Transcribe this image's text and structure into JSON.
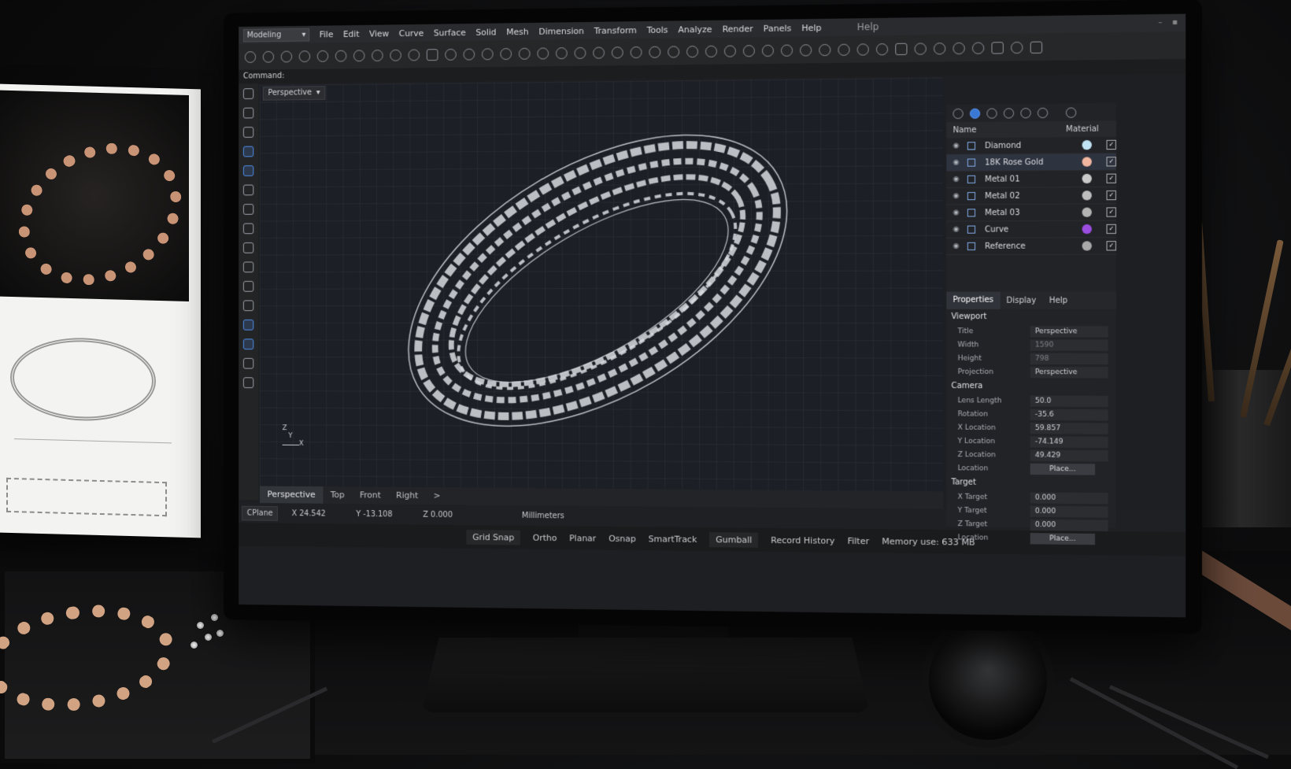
{
  "app": {
    "workspace": "Modeling",
    "title": "Help"
  },
  "menu": [
    "File",
    "Edit",
    "View",
    "Curve",
    "Surface",
    "Solid",
    "Mesh",
    "Dimension",
    "Transform",
    "Tools",
    "Analyze",
    "Render",
    "Panels",
    "Help"
  ],
  "command": {
    "label": "Command:"
  },
  "viewport": {
    "name": "Perspective",
    "axis_z": "Z",
    "axis_y": "Y",
    "axis_x": "X"
  },
  "viewport_tabs": [
    "Perspective",
    "Top",
    "Front",
    "Right"
  ],
  "viewport_tabs_more": ">",
  "status": {
    "cplane": "CPlane",
    "x": "X 24.542",
    "y": "Y -13.108",
    "z": "Z 0.000",
    "units": "Millimeters"
  },
  "osnap": [
    "Grid Snap",
    "Ortho",
    "Planar",
    "Osnap",
    "SmartTrack",
    "Gumball",
    "Record History",
    "Filter"
  ],
  "memory": "Memory use: 633 MB",
  "layers": {
    "name_header": "Name",
    "material_header": "Material",
    "items": [
      {
        "name": "Diamond",
        "color": "#bfe3f5"
      },
      {
        "name": "18K Rose Gold",
        "color": "#f0b6a0"
      },
      {
        "name": "Metal 01",
        "color": "#c9c9c9"
      },
      {
        "name": "Metal 02",
        "color": "#bdbdbd"
      },
      {
        "name": "Metal 03",
        "color": "#b3b3b3"
      },
      {
        "name": "Curve",
        "color": "#9b4de0"
      },
      {
        "name": "Reference",
        "color": "#a9a9a9"
      }
    ]
  },
  "props_tabs": [
    "Properties",
    "Display",
    "Help"
  ],
  "viewport_section": {
    "title": "Viewport",
    "rows": [
      {
        "k": "Title",
        "v": "Perspective"
      },
      {
        "k": "Width",
        "v": "1590"
      },
      {
        "k": "Height",
        "v": "798"
      },
      {
        "k": "Projection",
        "v": "Perspective"
      }
    ]
  },
  "camera_section": {
    "title": "Camera",
    "rows": [
      {
        "k": "Lens Length",
        "v": "50.0"
      },
      {
        "k": "Rotation",
        "v": "-35.6"
      },
      {
        "k": "X Location",
        "v": "59.857"
      },
      {
        "k": "Y Location",
        "v": "-74.149"
      },
      {
        "k": "Z Location",
        "v": "49.429"
      }
    ],
    "location_label": "Location",
    "place_label": "Place..."
  },
  "target_section": {
    "title": "Target",
    "rows": [
      {
        "k": "X Target",
        "v": "0.000"
      },
      {
        "k": "Y Target",
        "v": "0.000"
      },
      {
        "k": "Z Target",
        "v": "0.000"
      }
    ],
    "location_label": "Location",
    "place_label": "Place..."
  }
}
